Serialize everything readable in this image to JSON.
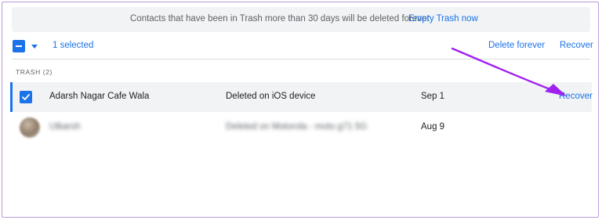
{
  "banner": {
    "message": "Contacts that have been in Trash more than 30 days will be deleted forever",
    "action": "Empty Trash now"
  },
  "toolbar": {
    "selected_count": "1 selected",
    "delete_forever": "Delete forever",
    "recover": "Recover"
  },
  "section_label": "TRASH (2)",
  "rows": [
    {
      "name": "Adarsh Nagar Cafe Wala",
      "note": "Deleted on iOS device",
      "date": "Sep 1",
      "action": "Recover",
      "selected": true
    },
    {
      "name": "Utkarsh",
      "note": "Deleted on Motorola - moto g71 5G",
      "date": "Aug 9",
      "selected": false
    }
  ],
  "colors": {
    "accent": "#1a73e8",
    "annotation_arrow": "#a020f0",
    "banner_bg": "#f1f3f4"
  },
  "icons": {
    "select_all": "indeterminate-checkbox",
    "select_menu": "caret-down",
    "row_check": "checked-checkbox"
  }
}
